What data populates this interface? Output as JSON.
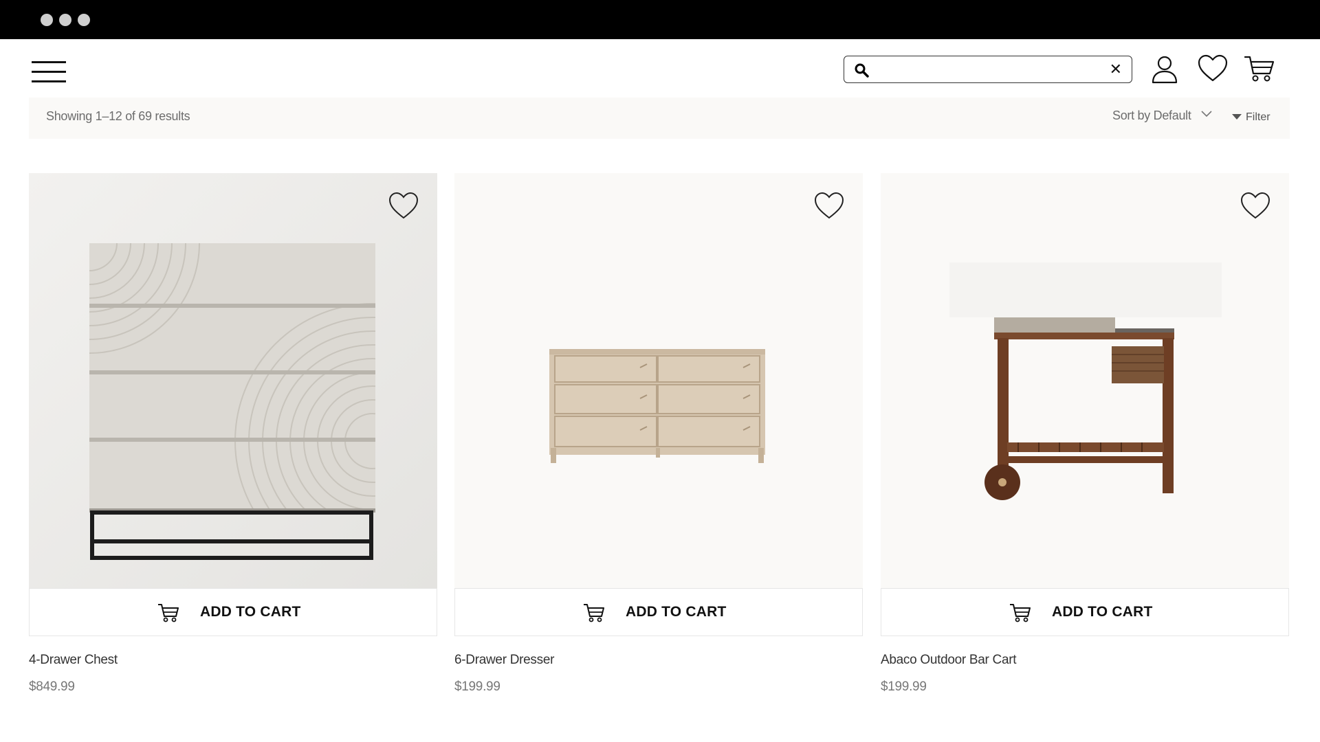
{
  "header": {
    "search_value": "",
    "search_placeholder": "",
    "clear_glyph": "✕"
  },
  "toolbar": {
    "results_text": "Showing 1–12 of 69 results",
    "sort_label": "Sort by Default",
    "filter_label": "Filter"
  },
  "products": [
    {
      "name": "4-Drawer Chest",
      "price": "$849.99",
      "cta": "ADD TO CART"
    },
    {
      "name": "6-Drawer Dresser",
      "price": "$199.99",
      "cta": "ADD TO CART"
    },
    {
      "name": "Abaco Outdoor Bar Cart",
      "price": "$199.99",
      "cta": "ADD TO CART"
    }
  ],
  "icons": [
    "menu-icon",
    "search-icon",
    "clear-icon",
    "account-icon",
    "wishlist-icon",
    "cart-icon",
    "chevron-down-icon",
    "filter-icon",
    "heart-icon"
  ]
}
